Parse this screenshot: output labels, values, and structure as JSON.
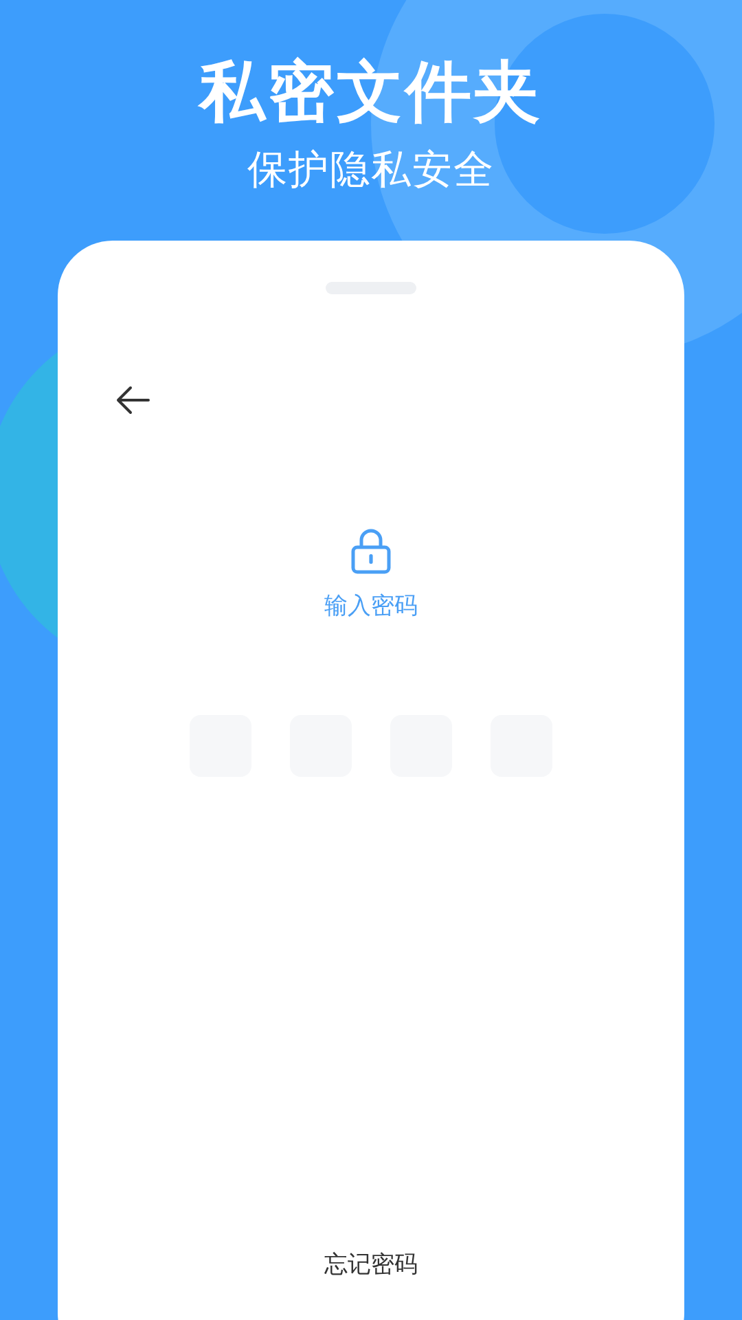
{
  "header": {
    "title": "私密文件夹",
    "subtitle": "保护隐私安全"
  },
  "screen": {
    "prompt": "输入密码",
    "pin_boxes": [
      {
        "filled": false
      },
      {
        "filled": false
      },
      {
        "filled": false
      },
      {
        "filled": false
      }
    ],
    "forgot_link": "忘记密码"
  }
}
